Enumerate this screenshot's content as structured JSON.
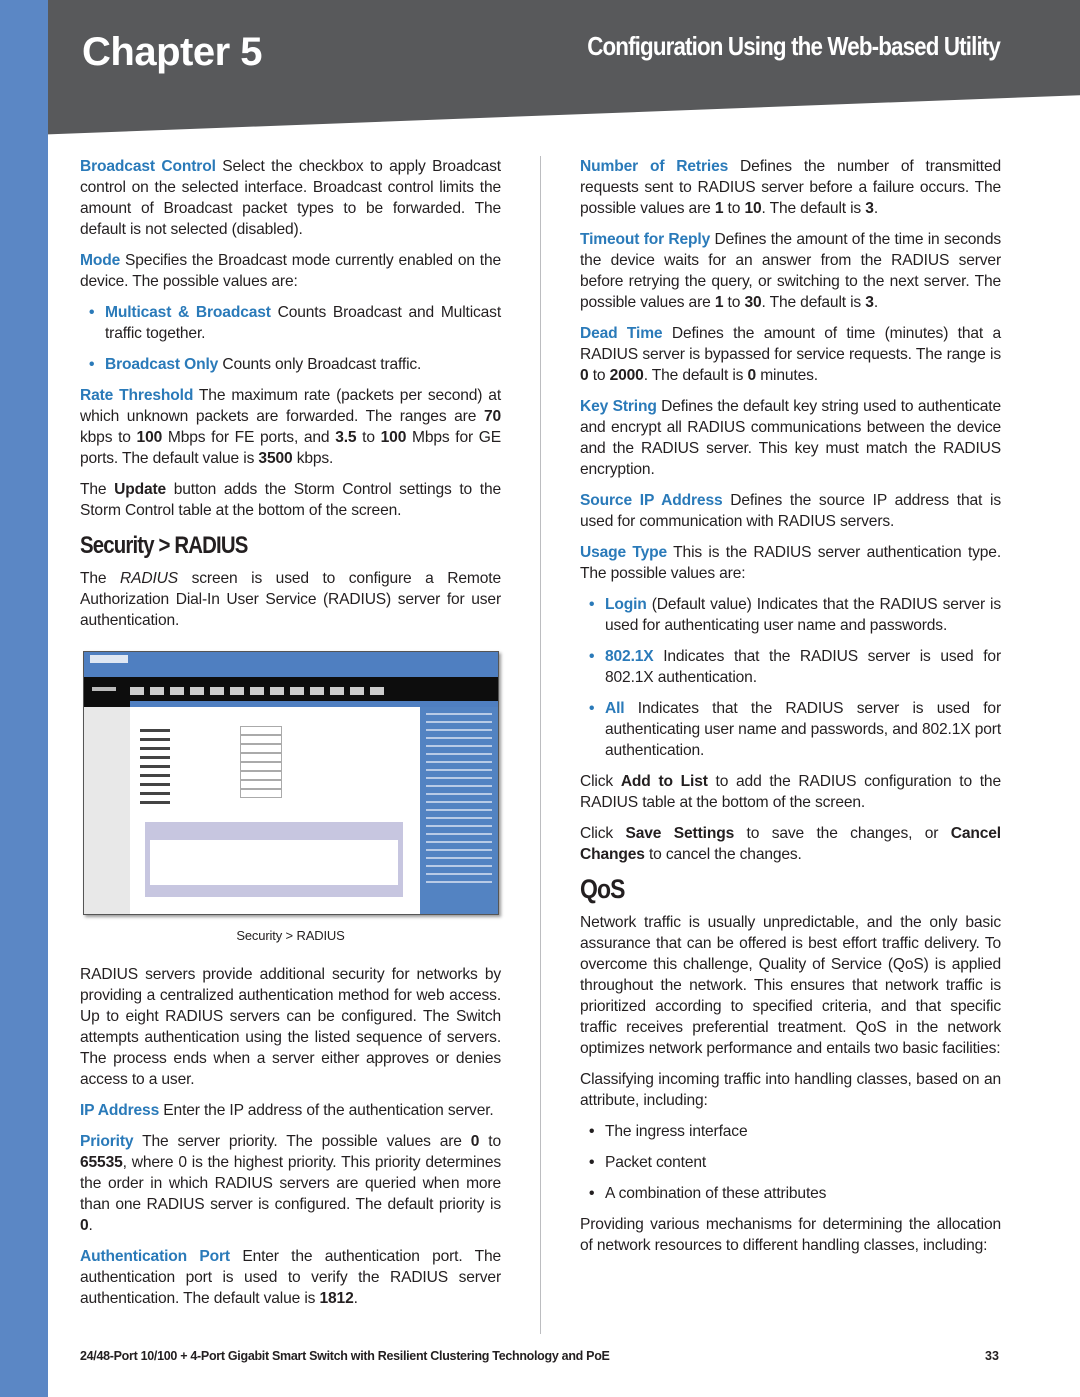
{
  "header": {
    "chapter": "Chapter 5",
    "title": "Configuration Using the Web-based Utility"
  },
  "colors": {
    "accent": "#2a7ab9",
    "header_bg": "#58595b",
    "side_strip": "#5b87c5"
  },
  "left": [
    {
      "type": "p",
      "segs": [
        {
          "s": "term",
          "t": "Broadcast Control"
        },
        {
          "t": " Select the checkbox to apply Broadcast control on the selected interface. Broadcast control limits the amount of Broadcast packet types to be forwarded. The default is not selected (disabled)."
        }
      ]
    },
    {
      "type": "p",
      "segs": [
        {
          "s": "term",
          "t": "Mode"
        },
        {
          "t": " Specifies the Broadcast mode currently enabled on the device. The possible values are:"
        }
      ]
    },
    {
      "type": "bullet",
      "segs": [
        {
          "s": "term",
          "t": "Multicast & Broadcast"
        },
        {
          "t": " Counts Broadcast and Multicast traffic together."
        }
      ]
    },
    {
      "type": "bullet",
      "segs": [
        {
          "s": "term",
          "t": "Broadcast Only"
        },
        {
          "t": " Counts only Broadcast traffic."
        }
      ]
    },
    {
      "type": "p",
      "segs": [
        {
          "s": "term",
          "t": "Rate Threshold"
        },
        {
          "t": " The maximum rate (packets per second) at which unknown packets are forwarded. The ranges are "
        },
        {
          "s": "b",
          "t": "70"
        },
        {
          "t": " kbps to "
        },
        {
          "s": "b",
          "t": "100"
        },
        {
          "t": " Mbps for FE ports, and "
        },
        {
          "s": "b",
          "t": "3.5"
        },
        {
          "t": " to "
        },
        {
          "s": "b",
          "t": "100"
        },
        {
          "t": " Mbps for GE ports. The default value is "
        },
        {
          "s": "b",
          "t": "3500"
        },
        {
          "t": " kbps."
        }
      ]
    },
    {
      "type": "p",
      "segs": [
        {
          "t": "The "
        },
        {
          "s": "b",
          "t": "Update"
        },
        {
          "t": " button adds the Storm Control settings to the Storm Control table at the bottom of the screen."
        }
      ]
    },
    {
      "type": "h2",
      "segs": [
        {
          "t": "Security > RADIUS"
        }
      ]
    },
    {
      "type": "p",
      "segs": [
        {
          "t": "The "
        },
        {
          "s": "i",
          "t": "RADIUS"
        },
        {
          "t": " screen is used to configure a Remote Authorization Dial-In User Service (RADIUS) server for user authentication."
        }
      ]
    },
    {
      "type": "figure"
    },
    {
      "type": "caption",
      "segs": [
        {
          "t": "Security > RADIUS"
        }
      ]
    },
    {
      "type": "p",
      "segs": [
        {
          "t": "RADIUS servers provide additional security for networks by providing a centralized authentication method for web access. Up to eight RADIUS servers can be configured. The Switch attempts authentication using the listed sequence of servers. The process ends when a server either approves or denies access to a user."
        }
      ]
    },
    {
      "type": "p",
      "segs": [
        {
          "s": "term",
          "t": "IP Address"
        },
        {
          "t": " Enter the IP address of the authentication server."
        }
      ]
    },
    {
      "type": "p",
      "segs": [
        {
          "s": "term",
          "t": "Priority"
        },
        {
          "t": " The server priority. The possible values are "
        },
        {
          "s": "b",
          "t": "0"
        },
        {
          "t": " to "
        },
        {
          "s": "b",
          "t": "65535"
        },
        {
          "t": ", where 0 is the highest priority. This priority determines the order in which RADIUS servers are queried when more than one RADIUS server is configured. The default priority is "
        },
        {
          "s": "b",
          "t": "0"
        },
        {
          "t": "."
        }
      ]
    },
    {
      "type": "p",
      "segs": [
        {
          "s": "term",
          "t": "Authentication Port"
        },
        {
          "t": " Enter the authentication port. The authentication port is used to verify the RADIUS server authentication. The default value is "
        },
        {
          "s": "b",
          "t": "1812"
        },
        {
          "t": "."
        }
      ]
    }
  ],
  "right": [
    {
      "type": "p",
      "segs": [
        {
          "s": "term",
          "t": "Number of Retries"
        },
        {
          "t": " Defines the number of transmitted requests sent to RADIUS server before a failure occurs. The possible values are "
        },
        {
          "s": "b",
          "t": "1"
        },
        {
          "t": " to "
        },
        {
          "s": "b",
          "t": "10"
        },
        {
          "t": ". The default is "
        },
        {
          "s": "b",
          "t": "3"
        },
        {
          "t": "."
        }
      ]
    },
    {
      "type": "p",
      "segs": [
        {
          "s": "term",
          "t": "Timeout for Reply"
        },
        {
          "t": " Defines the amount of the time in seconds the device waits for an answer from the RADIUS server before retrying the query, or switching to the next server. The possible values are "
        },
        {
          "s": "b",
          "t": "1"
        },
        {
          "t": " to "
        },
        {
          "s": "b",
          "t": "30"
        },
        {
          "t": ". The default is "
        },
        {
          "s": "b",
          "t": "3"
        },
        {
          "t": "."
        }
      ]
    },
    {
      "type": "p",
      "segs": [
        {
          "s": "term",
          "t": "Dead Time"
        },
        {
          "t": " Defines the amount of time (minutes) that a RADIUS server is bypassed for service requests. The range is "
        },
        {
          "s": "b",
          "t": "0"
        },
        {
          "t": " to "
        },
        {
          "s": "b",
          "t": "2000"
        },
        {
          "t": ". The default is "
        },
        {
          "s": "b",
          "t": "0"
        },
        {
          "t": " minutes."
        }
      ]
    },
    {
      "type": "p",
      "segs": [
        {
          "s": "term",
          "t": "Key String"
        },
        {
          "t": " Defines the default key string used to authenticate and encrypt all RADIUS communications between the device and the RADIUS server. This key must match the RADIUS encryption."
        }
      ]
    },
    {
      "type": "p",
      "segs": [
        {
          "s": "term",
          "t": "Source IP Address"
        },
        {
          "t": " Defines the source IP address that is used for communication with RADIUS servers."
        }
      ]
    },
    {
      "type": "p",
      "segs": [
        {
          "s": "term",
          "t": "Usage Type"
        },
        {
          "t": " This is the RADIUS server authentication type. The possible values are:"
        }
      ]
    },
    {
      "type": "bullet",
      "segs": [
        {
          "s": "term",
          "t": "Login"
        },
        {
          "t": " (Default value) Indicates that the RADIUS server is used for authenticating user name and passwords."
        }
      ]
    },
    {
      "type": "bullet",
      "segs": [
        {
          "s": "term",
          "t": "802.1X"
        },
        {
          "t": " Indicates that the RADIUS server is used for 802.1X authentication."
        }
      ]
    },
    {
      "type": "bullet",
      "segs": [
        {
          "s": "term",
          "t": "All"
        },
        {
          "t": " Indicates that the RADIUS server is used for authenticating user name and passwords, and 802.1X port authentication."
        }
      ]
    },
    {
      "type": "p",
      "segs": [
        {
          "t": "Click "
        },
        {
          "s": "b",
          "t": "Add to List"
        },
        {
          "t": " to add the RADIUS configuration to the RADIUS table at the bottom of the screen."
        }
      ]
    },
    {
      "type": "p",
      "segs": [
        {
          "t": "Click "
        },
        {
          "s": "b",
          "t": "Save Settings"
        },
        {
          "t": " to save the changes, or "
        },
        {
          "s": "b",
          "t": "Cancel Changes"
        },
        {
          "t": " to cancel the changes."
        }
      ]
    },
    {
      "type": "h2big",
      "segs": [
        {
          "t": "QoS"
        }
      ]
    },
    {
      "type": "p",
      "segs": [
        {
          "t": "Network traffic is usually unpredictable, and the only basic assurance that can be offered is best effort traffic delivery. To overcome this challenge, Quality of Service (QoS) is applied throughout the network. This ensures that network traffic is prioritized according to specified criteria, and that specific traffic receives preferential treatment. QoS in the network optimizes network performance and entails two basic facilities:"
        }
      ]
    },
    {
      "type": "p",
      "segs": [
        {
          "t": "Classifying incoming traffic into handling classes, based on an attribute, including:"
        }
      ]
    },
    {
      "type": "pbullet",
      "segs": [
        {
          "t": "The ingress interface"
        }
      ]
    },
    {
      "type": "pbullet",
      "segs": [
        {
          "t": "Packet content"
        }
      ]
    },
    {
      "type": "pbullet",
      "segs": [
        {
          "t": "A combination of these attributes"
        }
      ]
    },
    {
      "type": "p",
      "segs": [
        {
          "t": "Providing various mechanisms for determining the allocation of network resources to different handling classes, including:"
        }
      ]
    }
  ],
  "footer": {
    "text": "24/48-Port 10/100 + 4-Port Gigabit Smart Switch with Resilient Clustering Technology and PoE",
    "page": "33"
  }
}
